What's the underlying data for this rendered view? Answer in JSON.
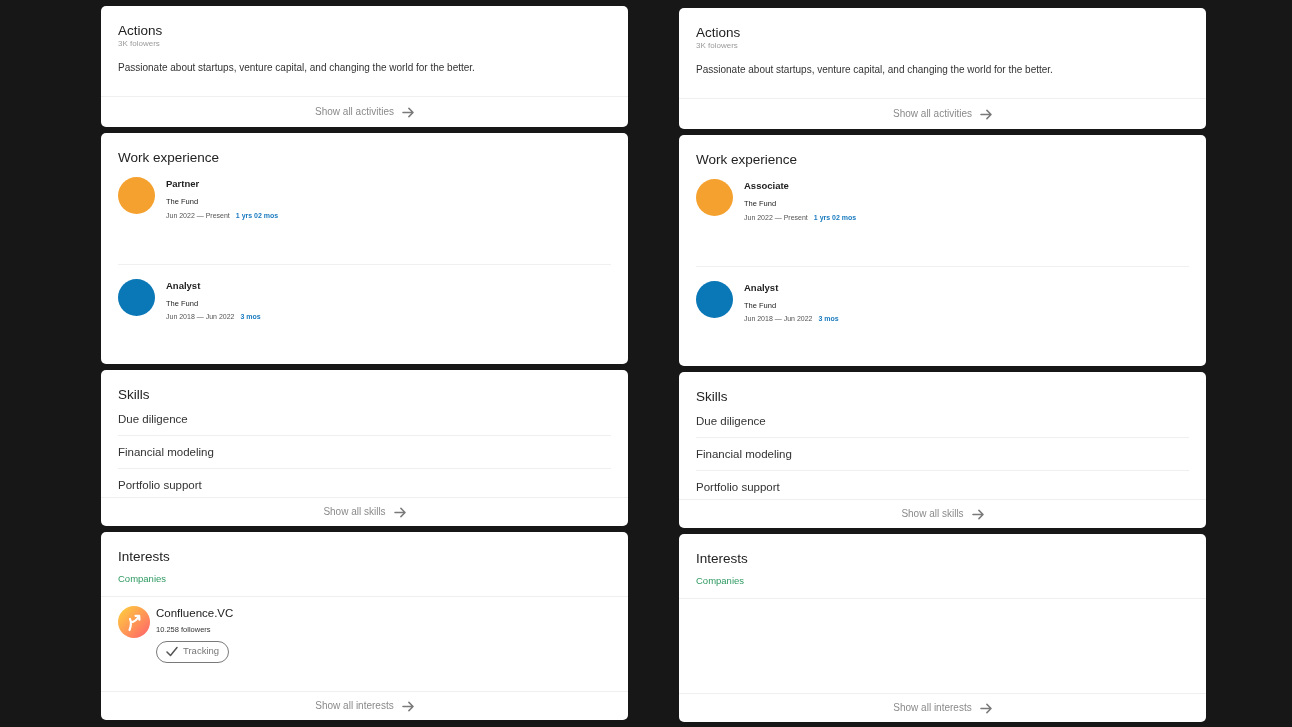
{
  "panels": [
    {
      "actions": {
        "title": "Actions",
        "followers": "3K folowers",
        "bio": "Passionate about startups, venture capital, and changing the world for the better.",
        "footer_link": "Show all activities"
      },
      "work_experience": {
        "title": "Work experience",
        "items": [
          {
            "role": "Partner",
            "company": "The Fund",
            "period": "Jun 2022 — Present",
            "duration": "1 yrs 02 mos",
            "color": "#f5a12f"
          },
          {
            "role": "Analyst",
            "company": "The Fund",
            "period": "Jun 2018 — Jun 2022",
            "duration": "3 mos",
            "color": "#0a77b7"
          }
        ]
      },
      "skills": {
        "title": "Skills",
        "items": [
          "Due diligence",
          "Financial modeling",
          "Portfolio support"
        ],
        "footer_link": "Show all skills"
      },
      "interests": {
        "title": "Interests",
        "tabs": [
          {
            "label": "Companies",
            "selected": true
          }
        ],
        "companies": [
          {
            "name": "Confluence.VC",
            "followers": "10.258 followers",
            "button": "Tracking"
          }
        ],
        "footer_link": "Show all interests"
      }
    },
    {
      "actions": {
        "title": "Actions",
        "followers": "3K folowers",
        "bio": "Passionate about startups, venture capital, and changing the world for the better.",
        "footer_link": "Show all activities"
      },
      "work_experience": {
        "title": "Work experience",
        "items": [
          {
            "role": "Associate",
            "company": "The Fund",
            "period": "Jun 2022 — Present",
            "duration": "1 yrs 02 mos",
            "color": "#f5a12f"
          },
          {
            "role": "Analyst",
            "company": "The Fund",
            "period": "Jun 2018 — Jun 2022",
            "duration": "3 mos",
            "color": "#0a77b7"
          }
        ]
      },
      "skills": {
        "title": "Skills",
        "items": [
          "Due diligence",
          "Financial modeling",
          "Portfolio support"
        ],
        "footer_link": "Show all skills"
      },
      "interests": {
        "title": "Interests",
        "tabs": [
          {
            "label": "Companies",
            "selected": true
          }
        ],
        "footer_link": "Show all interests"
      }
    }
  ]
}
